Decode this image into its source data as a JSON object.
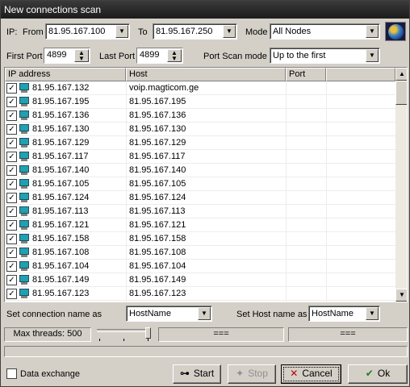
{
  "window": {
    "title": "New connections scan"
  },
  "ip_range": {
    "ip_label": "IP:",
    "from_label": "From",
    "from_value": "81.95.167.100",
    "to_label": "To",
    "to_value": "81.95.167.250"
  },
  "mode": {
    "label": "Mode",
    "value": "All Nodes"
  },
  "ports": {
    "first_label": "First Port",
    "first_value": "4899",
    "last_label": "Last Port",
    "last_value": "4899",
    "scan_mode_label": "Port Scan mode",
    "scan_mode_value": "Up to the first"
  },
  "grid": {
    "columns": [
      "IP address",
      "Host",
      "Port"
    ],
    "rows": [
      {
        "ip": "81.95.167.132",
        "host": "voip.magticom.ge",
        "checked": true
      },
      {
        "ip": "81.95.167.195",
        "host": "81.95.167.195",
        "checked": true
      },
      {
        "ip": "81.95.167.136",
        "host": "81.95.167.136",
        "checked": true
      },
      {
        "ip": "81.95.167.130",
        "host": "81.95.167.130",
        "checked": true
      },
      {
        "ip": "81.95.167.129",
        "host": "81.95.167.129",
        "checked": true
      },
      {
        "ip": "81.95.167.117",
        "host": "81.95.167.117",
        "checked": true
      },
      {
        "ip": "81.95.167.140",
        "host": "81.95.167.140",
        "checked": true
      },
      {
        "ip": "81.95.167.105",
        "host": "81.95.167.105",
        "checked": true
      },
      {
        "ip": "81.95.167.124",
        "host": "81.95.167.124",
        "checked": true
      },
      {
        "ip": "81.95.167.113",
        "host": "81.95.167.113",
        "checked": true
      },
      {
        "ip": "81.95.167.121",
        "host": "81.95.167.121",
        "checked": true
      },
      {
        "ip": "81.95.167.158",
        "host": "81.95.167.158",
        "checked": true
      },
      {
        "ip": "81.95.167.108",
        "host": "81.95.167.108",
        "checked": true
      },
      {
        "ip": "81.95.167.104",
        "host": "81.95.167.104",
        "checked": true
      },
      {
        "ip": "81.95.167.149",
        "host": "81.95.167.149",
        "checked": true
      },
      {
        "ip": "81.95.167.123",
        "host": "81.95.167.123",
        "checked": true
      }
    ]
  },
  "naming": {
    "connection_label": "Set connection name as",
    "connection_value": "HostName",
    "host_label": "Set Host name as",
    "host_value": "HostName"
  },
  "status": {
    "threads_label": "Max threads: 500",
    "panel2": "===",
    "panel3": "==="
  },
  "footer": {
    "data_exchange_label": "Data exchange",
    "start_label": "Start",
    "stop_label": "Stop",
    "cancel_label": "Cancel",
    "ok_label": "Ok"
  }
}
